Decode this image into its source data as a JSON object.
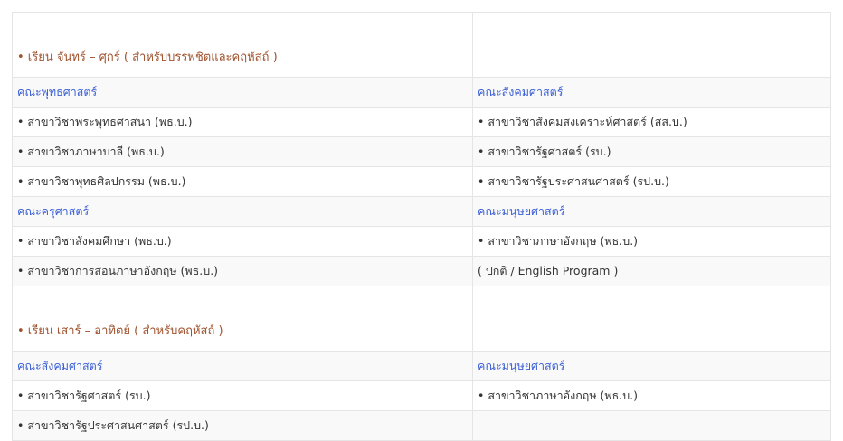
{
  "sections": [
    {
      "title": "• เรียน จันทร์ – ศุกร์ ( สำหรับบรรพชิตและคฤหัสถ์ )",
      "faculty_rows": [
        {
          "left_faculty": "คณะพุทธศาสตร์",
          "right_faculty": "คณะสังคมศาสตร์",
          "items": [
            [
              "• สาขาวิชาพระพุทธศาสนา (พธ.บ.)",
              "• สาขาวิชาสังคมสงเคราะห์ศาสตร์ (สส.บ.)"
            ],
            [
              "• สาขาวิชาภาษาบาลี (พธ.บ.)",
              "• สาขาวิชารัฐศาสตร์ (รบ.)"
            ],
            [
              "• สาขาวิชาพุทธศิลปกรรม (พธ.บ.)",
              "• สาขาวิชารัฐประศาสนศาสตร์ (รป.บ.)"
            ]
          ]
        },
        {
          "left_faculty": "คณะครุศาสตร์",
          "right_faculty": "คณะมนุษยศาสตร์",
          "items": [
            [
              "• สาขาวิชาสังคมศึกษา (พธ.บ.)",
              "• สาขาวิชาภาษาอังกฤษ (พธ.บ.)"
            ],
            [
              "• สาขาวิชาการสอนภาษาอังกฤษ (พธ.บ.)",
              "( ปกติ / English Program )"
            ]
          ]
        }
      ]
    },
    {
      "title": "• เรียน เสาร์ – อาทิตย์ ( สำหรับคฤหัสถ์ )",
      "faculty_rows": [
        {
          "left_faculty": "คณะสังคมศาสตร์",
          "right_faculty": "คณะมนุษยศาสตร์",
          "items": [
            [
              "• สาขาวิชารัฐศาสตร์ (รบ.)",
              "• สาขาวิชาภาษาอังกฤษ (พธ.บ.)"
            ],
            [
              "• สาขาวิชารัฐประศาสนศาสตร์ (รป.บ.)",
              ""
            ]
          ]
        }
      ]
    }
  ]
}
